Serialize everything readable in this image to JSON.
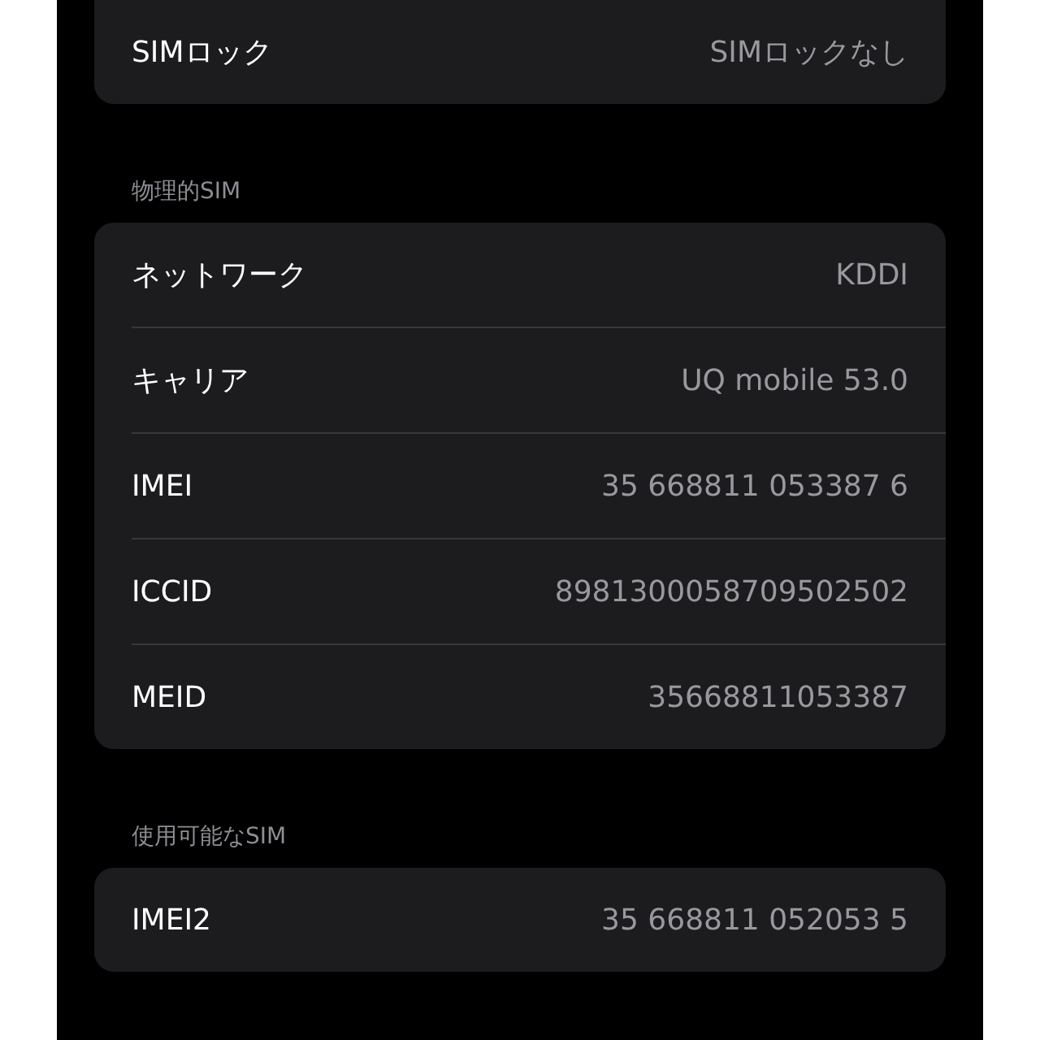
{
  "groups": [
    {
      "rows": [
        {
          "label": "SIMロック",
          "value": "SIMロックなし"
        }
      ]
    },
    {
      "header": "物理的SIM",
      "rows": [
        {
          "label": "ネットワーク",
          "value": "KDDI"
        },
        {
          "label": "キャリア",
          "value": "UQ mobile 53.0"
        },
        {
          "label": "IMEI",
          "value": "35 668811 053387 6"
        },
        {
          "label": "ICCID",
          "value": "8981300058709502502"
        },
        {
          "label": "MEID",
          "value": "35668811053387"
        }
      ]
    },
    {
      "header": "使用可能なSIM",
      "rows": [
        {
          "label": "IMEI2",
          "value": "35 668811 052053 5"
        }
      ]
    }
  ]
}
